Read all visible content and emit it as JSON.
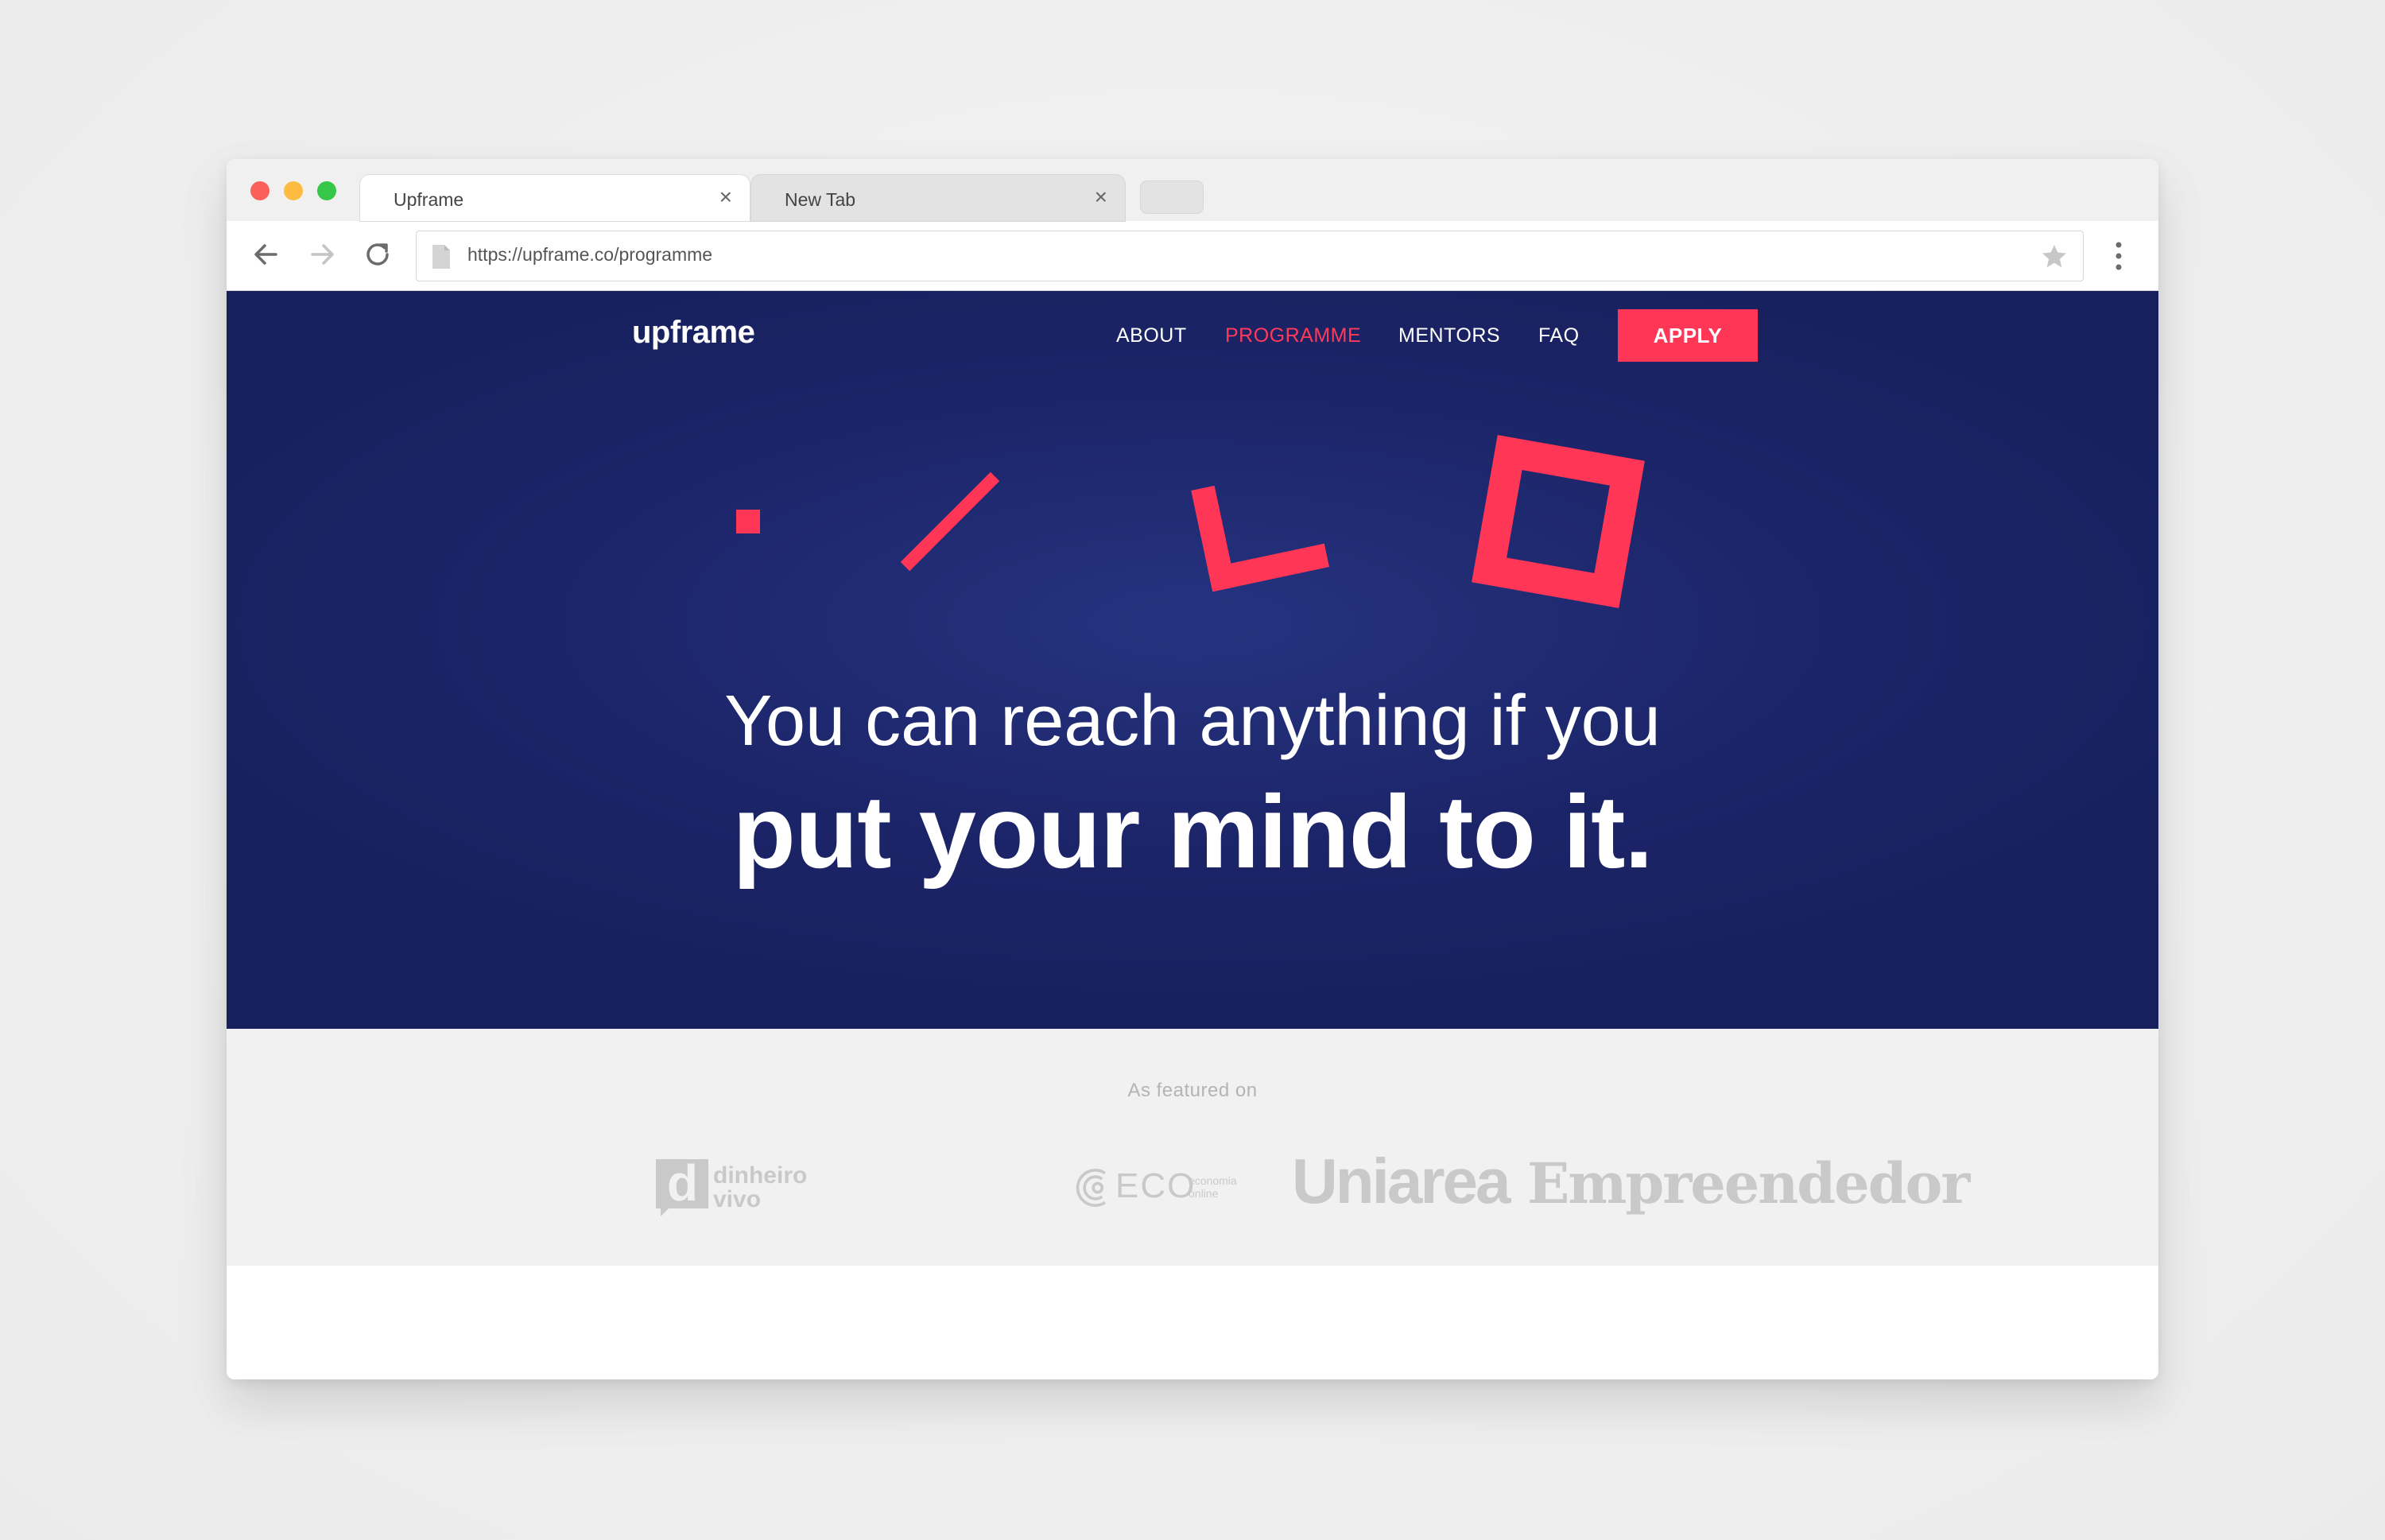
{
  "browser": {
    "tabs": [
      {
        "label": "Upframe",
        "active": true,
        "close_icon": "close-icon"
      },
      {
        "label": "New Tab",
        "active": false,
        "close_icon": "close-icon"
      }
    ],
    "url": "https://upframe.co/programme",
    "icons": [
      "back-arrow-icon",
      "forward-arrow-icon",
      "reload-icon",
      "page-icon",
      "star-icon",
      "menu-dots-icon"
    ]
  },
  "site": {
    "brand": "upframe",
    "nav": {
      "about": "ABOUT",
      "programme": "PROGRAMME",
      "mentors": "MENTORS",
      "faq": "FAQ",
      "apply": "APPLY"
    },
    "hero": {
      "line1": "You can reach anything if you",
      "line2": "put your mind to it."
    },
    "featured": {
      "title": "As featured on",
      "logos": {
        "dinheiro_line1": "dinheiro",
        "dinheiro_line2": "vivo",
        "dinheiro_mark": "d",
        "eco": "ECO",
        "eco_sub1": "economia",
        "eco_sub2": "online",
        "uniarea": "Uniarea",
        "empreendedor": "Empreendedor"
      }
    }
  },
  "colors": {
    "accent": "#ff3656",
    "hero_bg": "#1c2468",
    "featured_bg": "#f1f1f1",
    "logo_gray": "#c9c9c9"
  }
}
